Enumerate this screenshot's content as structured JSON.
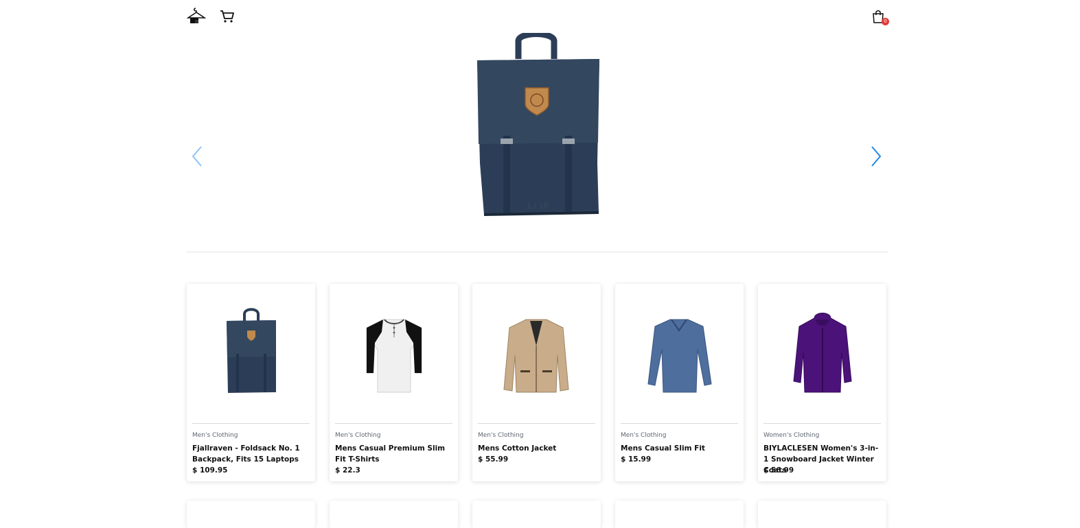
{
  "nav": {
    "logo_icon": "hanger-house-icon",
    "cart_icon": "shopping-cart-icon",
    "bag_icon": "shopping-bag-icon",
    "bag_count": "0"
  },
  "carousel": {
    "counter": "1 / 10",
    "prev_icon": "chevron-left-icon",
    "next_icon": "chevron-right-icon"
  },
  "products": [
    {
      "category": "Men's Clothing",
      "title": "Fjallraven - Foldsack No. 1 Backpack, Fits 15 Laptops",
      "price": "$ 109.95",
      "icon": "backpack"
    },
    {
      "category": "Men's Clothing",
      "title": "Mens Casual Premium Slim Fit T-Shirts",
      "price": "$ 22.3",
      "icon": "raglan-shirt"
    },
    {
      "category": "Men's Clothing",
      "title": "Mens Cotton Jacket",
      "price": "$ 55.99",
      "icon": "cotton-jacket"
    },
    {
      "category": "Men's Clothing",
      "title": "Mens Casual Slim Fit",
      "price": "$ 15.99",
      "icon": "long-sleeve-shirt"
    },
    {
      "category": "Women's Clothing",
      "title": "BIYLACLESEN Women's 3-in-1 Snowboard Jacket Winter Coats",
      "price": "$ 56.99",
      "icon": "winter-jacket"
    }
  ],
  "colors": {
    "accent": "#1e88e5",
    "badge": "#e53935",
    "backpack": "#2c3e57",
    "jacket_purple": "#4b137a"
  }
}
